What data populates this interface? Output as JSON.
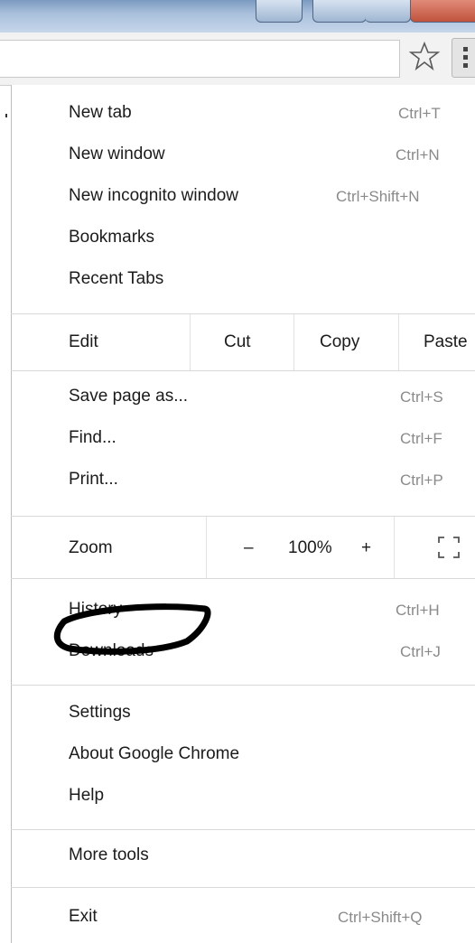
{
  "menu": {
    "group1": [
      {
        "label": "New tab",
        "shortcut": "Ctrl+T"
      },
      {
        "label": "New window",
        "shortcut": "Ctrl+N"
      },
      {
        "label": "New incognito window",
        "shortcut": "Ctrl+Shift+N"
      },
      {
        "label": "Bookmarks",
        "shortcut": ""
      },
      {
        "label": "Recent Tabs",
        "shortcut": ""
      }
    ],
    "edit": {
      "label": "Edit",
      "cut": "Cut",
      "copy": "Copy",
      "paste": "Paste"
    },
    "group2": [
      {
        "label": "Save page as...",
        "shortcut": "Ctrl+S"
      },
      {
        "label": "Find...",
        "shortcut": "Ctrl+F"
      },
      {
        "label": "Print...",
        "shortcut": "Ctrl+P"
      }
    ],
    "zoom": {
      "label": "Zoom",
      "minus": "–",
      "value": "100%",
      "plus": "+"
    },
    "group3": [
      {
        "label": "History",
        "shortcut": "Ctrl+H"
      },
      {
        "label": "Downloads",
        "shortcut": "Ctrl+J"
      }
    ],
    "group4": [
      {
        "label": "Settings"
      },
      {
        "label": "About Google Chrome"
      },
      {
        "label": "Help"
      }
    ],
    "more_tools": "More tools",
    "exit": {
      "label": "Exit",
      "shortcut": "Ctrl+Shift+Q"
    }
  },
  "icons": {
    "star": "bookmark-star-icon",
    "menu": "chrome-menu-icon",
    "fullscreen": "fullscreen-icon"
  },
  "colors": {
    "shortcut_text": "#8a8a8a",
    "annotation": "#000000"
  }
}
